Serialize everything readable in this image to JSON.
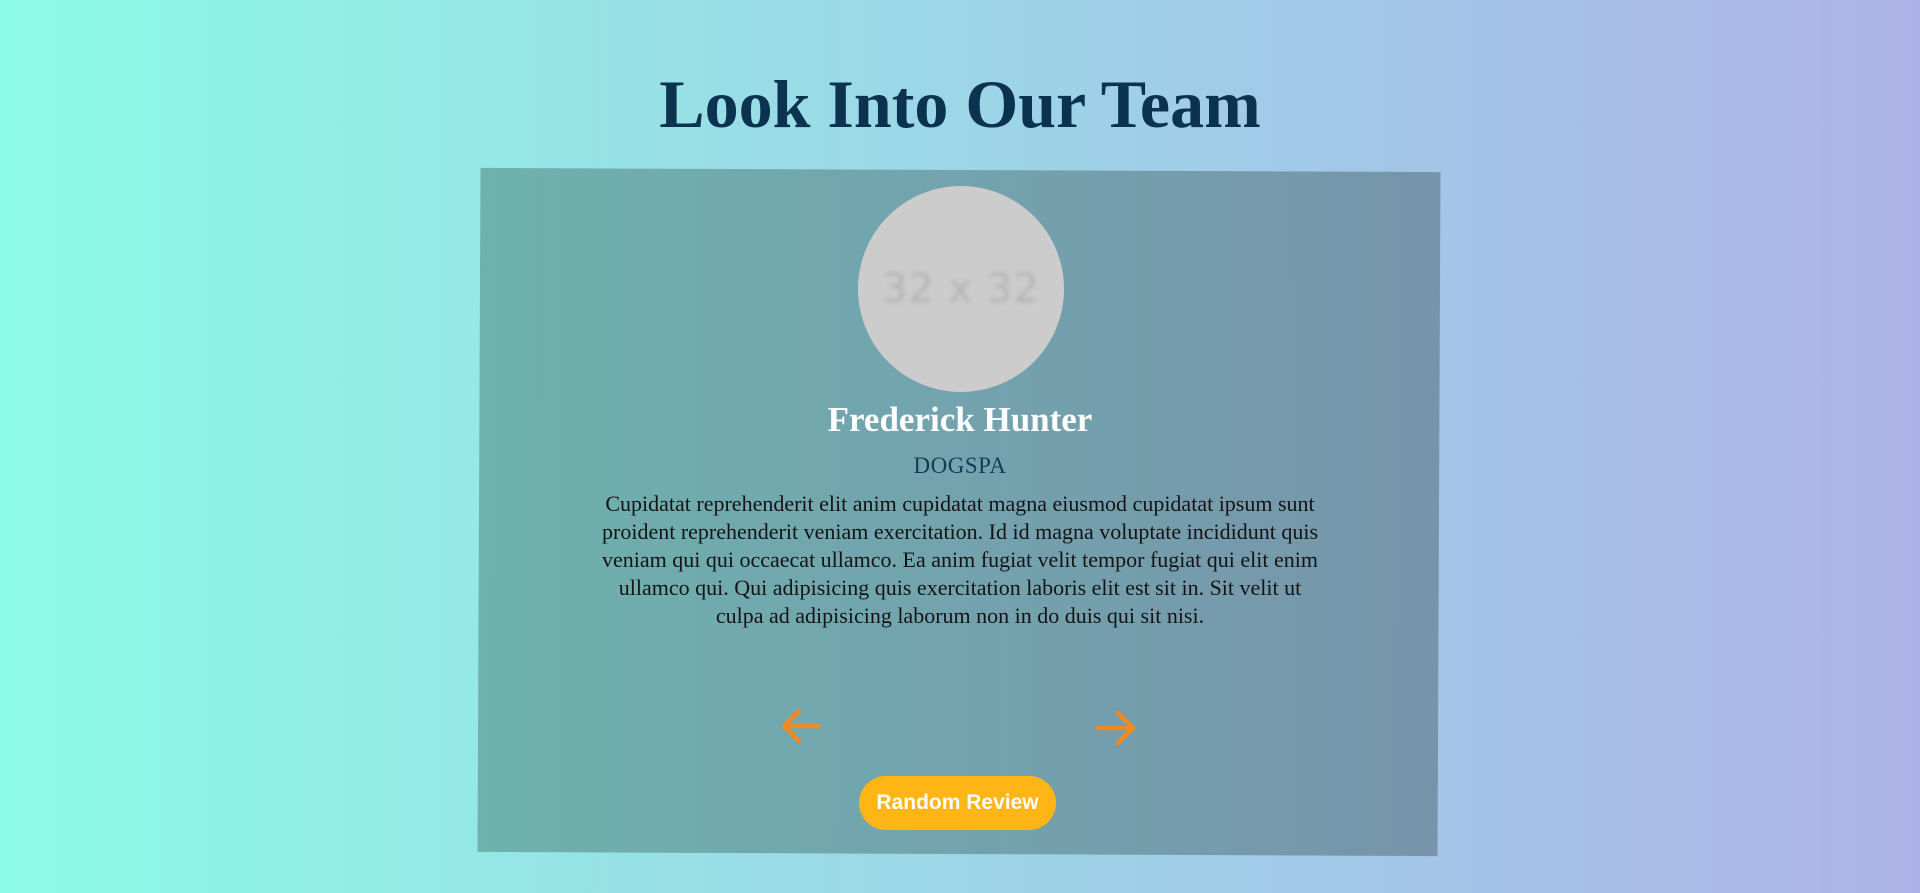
{
  "page": {
    "title": "Look Into Our Team"
  },
  "review": {
    "avatar_placeholder": "32 x 32",
    "name": "Frederick Hunter",
    "company": "DOGSPA",
    "text": "Cupidatat reprehenderit elit anim cupidatat magna eiusmod cupidatat ipsum sunt proident reprehenderit veniam exercitation. Id id magna voluptate incididunt quis veniam qui qui occaecat ullamco. Ea anim fugiat velit tempor fugiat qui elit enim ullamco qui. Qui adipisicing quis exercitation laboris elit est sit in. Sit velit ut culpa ad adipisicing laborum non in do duis qui sit nisi."
  },
  "controls": {
    "prev_icon": "arrow-left-icon",
    "next_icon": "arrow-right-icon",
    "random_label": "Random Review"
  },
  "colors": {
    "arrow": "#f08a24",
    "button": "#ffb515",
    "title": "#0b3350"
  }
}
